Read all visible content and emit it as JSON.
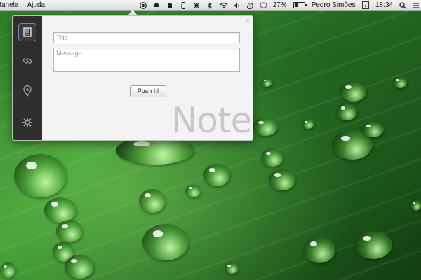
{
  "menubar": {
    "menus": [
      "Janela",
      "Ajuda"
    ],
    "battery_percent": "27%",
    "user_name": "Pedro Simões",
    "date_badge": "7",
    "time": "18:34",
    "status_icons": [
      "pushbullet-icon",
      "bell-icon",
      "evernote-icon",
      "phone-icon",
      "gadget-icon",
      "bluetooth-icon",
      "wifi-icon",
      "volume-icon",
      "time-machine-icon",
      "chat-icon",
      "battery-icon",
      "calendar-icon",
      "search-icon",
      "list-icon"
    ]
  },
  "popover": {
    "title_placeholder": "Title",
    "message_placeholder": "Message",
    "push_button_label": "Push It!",
    "note_label": "Note",
    "close_glyph": "×",
    "accent_color": "#4a90d9",
    "sidebar_items": [
      "note-icon",
      "link-icon",
      "location-icon",
      "settings-icon"
    ],
    "active_item": "note-icon"
  }
}
